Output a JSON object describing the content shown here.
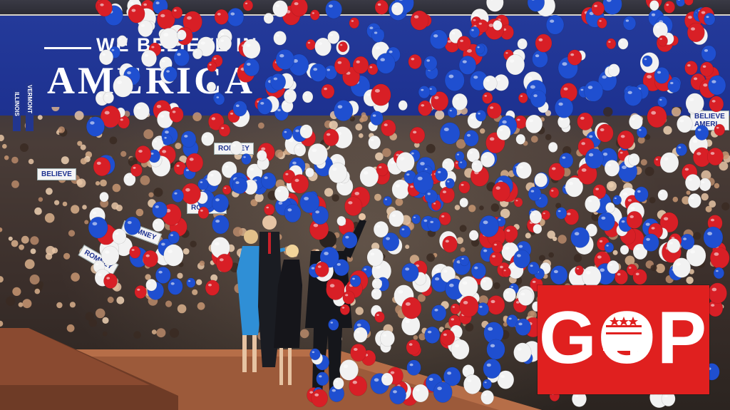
{
  "banner": {
    "slogan_line1": "WE BELIEVE IN",
    "slogan_line2": "AMERICA",
    "background_color": "#1d3190"
  },
  "signs": {
    "believe_left": "BELIEVE",
    "believe_right": "BELIEVE",
    "believe_right_line2": "AMERI",
    "romney_1": "ROMNEY",
    "romney_2": "ROMNEY",
    "romney_3": "ROMNEY",
    "romney_4": "ROMNEY",
    "vertical_1": "ILLINOIS",
    "vertical_2": "VERMONT"
  },
  "logo": {
    "text": "GOP",
    "background_color": "#e0201f",
    "icon": "elephant-icon"
  },
  "colors": {
    "balloon_red": "#d81f26",
    "balloon_blue": "#1f4fd0",
    "balloon_white": "#f2f2f2"
  }
}
